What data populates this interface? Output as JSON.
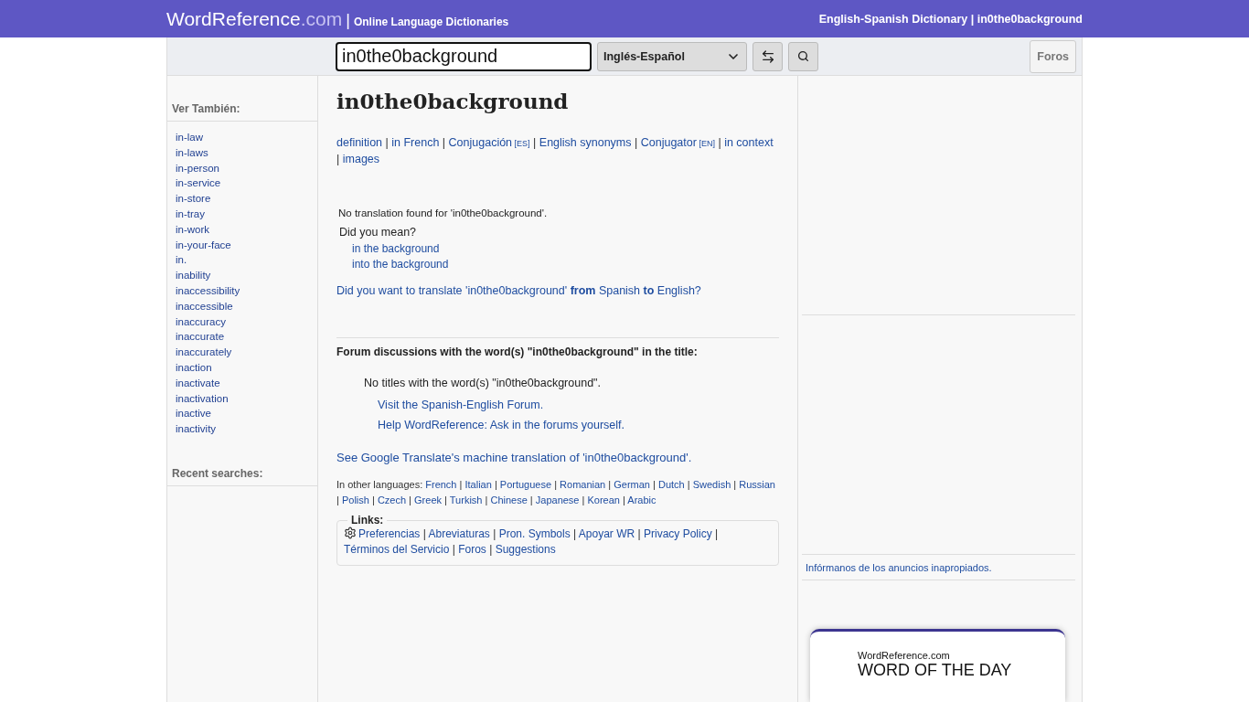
{
  "header": {
    "logo_main": "WordReference",
    "logo_suffix": ".com",
    "divider": "|",
    "tagline": "Online Language Dictionaries",
    "page_title": "English-Spanish Dictionary | in0the0background"
  },
  "toolbar": {
    "search_value": "in0the0background",
    "language": "Inglés-Español",
    "forums_button": "Foros"
  },
  "sidebar": {
    "see_also_title": "Ver También:",
    "see_also": [
      "in-law",
      "in-laws",
      "in-person",
      "in-service",
      "in-store",
      "in-tray",
      "in-work",
      "in-your-face",
      "in.",
      "inability",
      "inaccessibility",
      "inaccessible",
      "inaccuracy",
      "inaccurate",
      "inaccurately",
      "inaction",
      "inactivate",
      "inactivation",
      "inactive",
      "inactivity"
    ],
    "recent_title": "Recent searches:"
  },
  "main": {
    "headword": "in0the0background",
    "separator": "|",
    "tool_links": [
      {
        "text": "definition"
      },
      {
        "text": "in French"
      },
      {
        "text": "Conjugación",
        "tag": "[ES]"
      },
      {
        "text": "English synonyms"
      },
      {
        "text": "Conjugator",
        "tag": "[EN]"
      },
      {
        "text": "in context"
      },
      {
        "text": "images"
      }
    ],
    "no_translation": "No translation found for 'in0the0background'.",
    "did_you_mean": "Did you mean?",
    "suggestions": [
      "in the background",
      "into the background"
    ],
    "reverse_link": "Did you want to translate 'in0the0background' **from** Spanish **to** English?",
    "forum_heading": "Forum discussions with the word(s) \"in0the0background\" in the title:",
    "no_titles": "No titles with the word(s) \"in0the0background\".",
    "forum_links": [
      "Visit the Spanish-English Forum.",
      "Help WordReference: Ask in the forums yourself."
    ],
    "google_link": "See Google Translate's machine translation of 'in0the0background'.",
    "other_languages_label": "In other languages:",
    "other_languages": [
      "French",
      "Italian",
      "Portuguese",
      "Romanian",
      "German",
      "Dutch",
      "Swedish",
      "Russian",
      "Polish",
      "Czech",
      "Greek",
      "Turkish",
      "Chinese",
      "Japanese",
      "Korean",
      "Arabic"
    ],
    "links_title": "Links:",
    "links": [
      "Preferencias",
      "Abreviaturas",
      "Pron. Symbols",
      "Apoyar WR",
      "Privacy Policy",
      "Términos del Servicio",
      "Foros",
      "Suggestions"
    ]
  },
  "right": {
    "report_ads": "Infórmanos de los anuncios inapropiados.",
    "wotd_site": "WordReference.com",
    "wotd_title": "WORD OF THE DAY"
  }
}
